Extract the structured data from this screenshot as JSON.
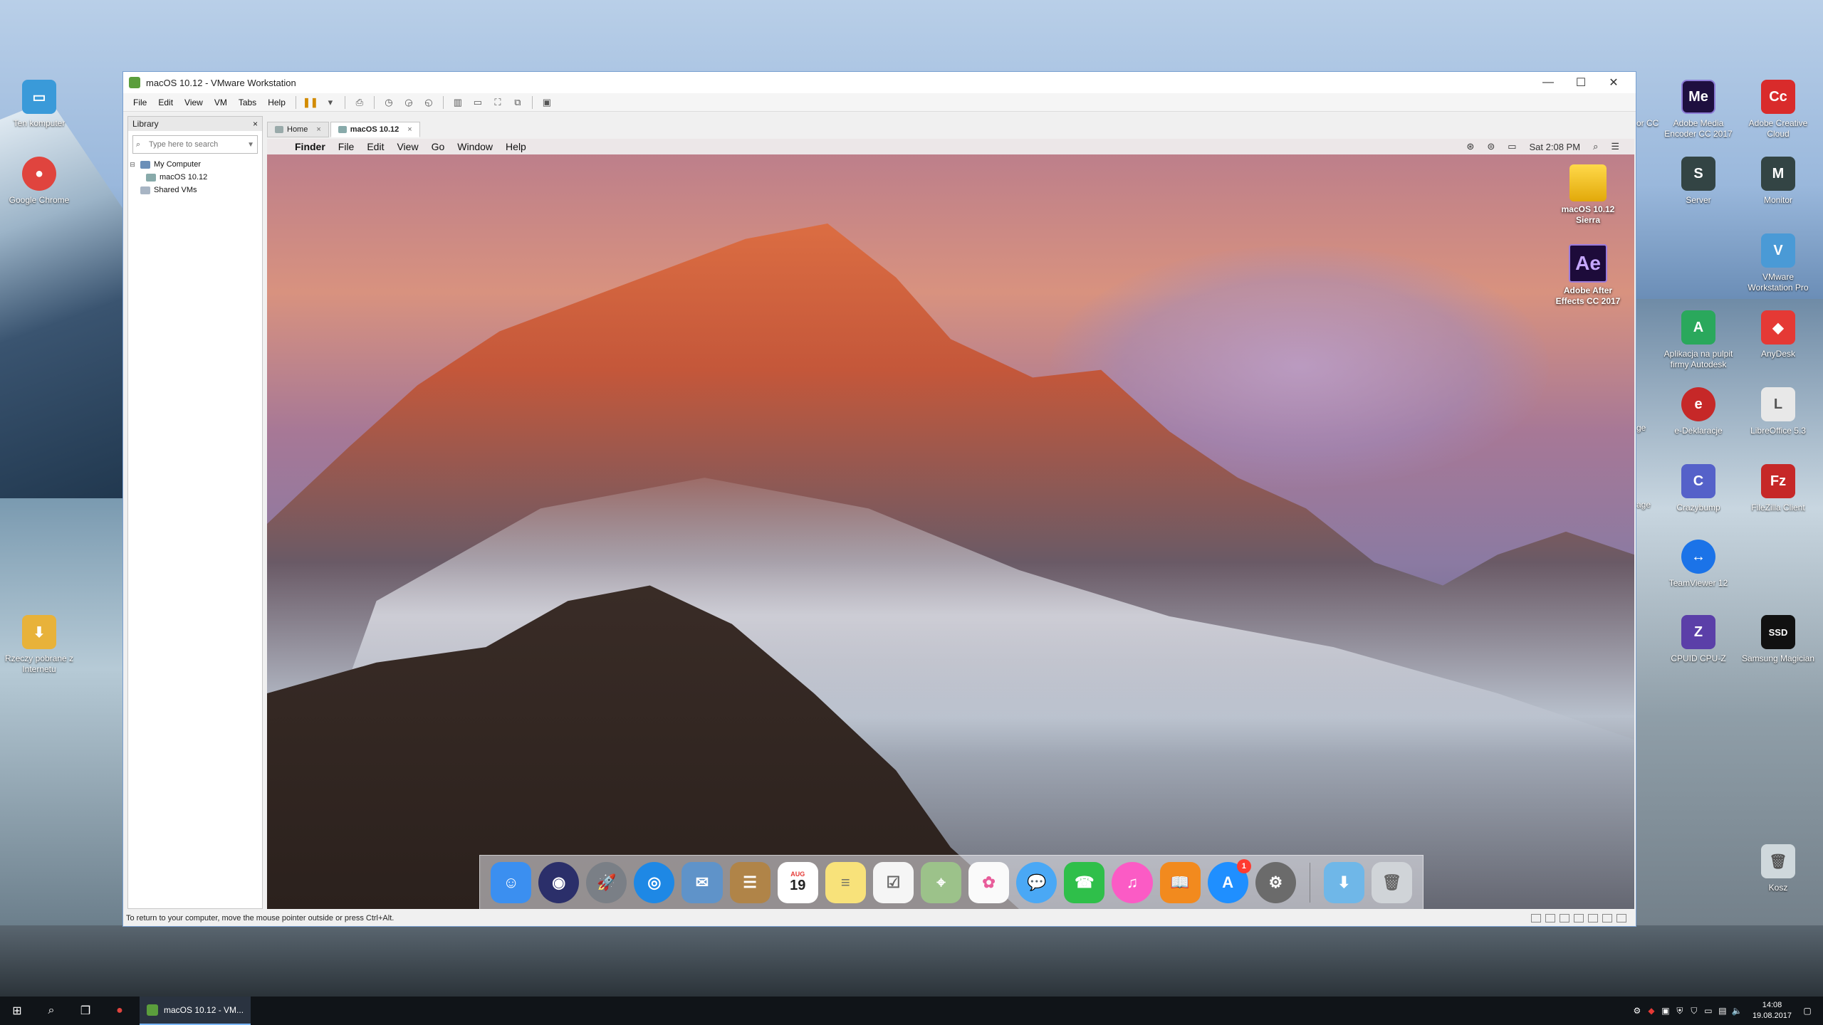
{
  "desktop": {
    "left_icons": [
      {
        "label": "Ten komputer",
        "icon": "computer-icon",
        "color": "#3a9ad9"
      },
      {
        "label": "Google Chrome",
        "icon": "chrome-icon",
        "color": "#e0443e"
      },
      {
        "label": "Rzeczy pobrane z Internetu",
        "icon": "downloads-folder-icon",
        "color": "#e8b23a"
      }
    ],
    "right_icons": [
      {
        "label": "Adobe Media Encoder CC 2017",
        "short": "Me",
        "color": "#1e0f3f"
      },
      {
        "label": "Adobe Creative Cloud",
        "short": "Cc",
        "color": "#d92b2b"
      },
      {
        "label": "Server",
        "short": "S",
        "color": "#344"
      },
      {
        "label": "Monitor",
        "short": "M",
        "color": "#344"
      },
      {
        "label": "VMware Workstation Pro",
        "short": "V",
        "color": "#4a9ad6"
      },
      {
        "label": "Aplikacja na pulpit firmy Autodesk",
        "short": "A",
        "color": "#2aa85c"
      },
      {
        "label": "AnyDesk",
        "short": "◆",
        "color": "#e53935"
      },
      {
        "label": "e-Deklaracje",
        "short": "e",
        "color": "#c62828"
      },
      {
        "label": "LibreOffice 5.3",
        "short": "L",
        "color": "#e8e8e8"
      },
      {
        "label": "Crazybump",
        "short": "C",
        "color": "#5561c9"
      },
      {
        "label": "FileZilla Client",
        "short": "Fz",
        "color": "#c62828"
      },
      {
        "label": "TeamViewer 12",
        "short": "↔",
        "color": "#1b73e8"
      },
      {
        "label": "CPUID CPU-Z",
        "short": "Z",
        "color": "#5b3fa8"
      },
      {
        "label": "Samsung Magician",
        "short": "SSD",
        "color": "#111"
      },
      {
        "label": "Kosz",
        "short": "🗑",
        "color": "#cfd8dc"
      }
    ],
    "partial_labels": [
      "or CC",
      "ge",
      "age"
    ]
  },
  "vmware": {
    "title": "macOS 10.12 - VMware Workstation",
    "window_controls": {
      "minimize": "—",
      "maximize": "☐",
      "close": "✕"
    },
    "menu": [
      "File",
      "Edit",
      "View",
      "VM",
      "Tabs",
      "Help"
    ],
    "library": {
      "header": "Library",
      "close": "×",
      "search_placeholder": "Type here to search",
      "tree": [
        {
          "label": "My Computer",
          "level": 0,
          "expander": "⊟"
        },
        {
          "label": "macOS 10.12",
          "level": 1,
          "expander": ""
        },
        {
          "label": "Shared VMs",
          "level": 0,
          "expander": ""
        }
      ]
    },
    "tabs": [
      {
        "label": "Home",
        "active": false
      },
      {
        "label": "macOS 10.12",
        "active": true
      }
    ],
    "status_text": "To return to your computer, move the mouse pointer outside or press Ctrl+Alt."
  },
  "mac": {
    "menu": [
      "Finder",
      "File",
      "Edit",
      "View",
      "Go",
      "Window",
      "Help"
    ],
    "clock": "Sat 2:08 PM",
    "desktop_icons": [
      {
        "label": "macOS 10.12 Sierra"
      },
      {
        "label": "Adobe After Effects CC 2017",
        "short": "Ae"
      }
    ],
    "dock": [
      {
        "name": "finder",
        "glyph": "☺",
        "color": "#3b8ff0"
      },
      {
        "name": "siri",
        "glyph": "◉",
        "color": "#2b2f6a"
      },
      {
        "name": "launchpad",
        "glyph": "🚀",
        "color": "#7a7f86"
      },
      {
        "name": "safari",
        "glyph": "◎",
        "color": "#1e88e5"
      },
      {
        "name": "mail",
        "glyph": "✉",
        "color": "#5f93c9"
      },
      {
        "name": "contacts",
        "glyph": "☰",
        "color": "#b08448"
      },
      {
        "name": "calendar",
        "glyph": "19",
        "color": "#ffffff",
        "sub": "AUG"
      },
      {
        "name": "notes",
        "glyph": "≡",
        "color": "#f8e27a"
      },
      {
        "name": "reminders",
        "glyph": "☑",
        "color": "#f5f5f5"
      },
      {
        "name": "maps",
        "glyph": "⌖",
        "color": "#9cc28a"
      },
      {
        "name": "photos",
        "glyph": "✿",
        "color": "#fafafa"
      },
      {
        "name": "messages",
        "glyph": "💬",
        "color": "#4aa8f5"
      },
      {
        "name": "facetime",
        "glyph": "☎",
        "color": "#2fbf4a"
      },
      {
        "name": "itunes",
        "glyph": "♫",
        "color": "#fb5bc5"
      },
      {
        "name": "ibooks",
        "glyph": "📖",
        "color": "#f28a1e"
      },
      {
        "name": "app-store",
        "glyph": "A",
        "color": "#1f8fff",
        "badge": "1"
      },
      {
        "name": "system-preferences",
        "glyph": "⚙",
        "color": "#6b6b6b"
      }
    ],
    "dock_right": [
      {
        "name": "downloads",
        "glyph": "⬇",
        "color": "#6fb7e8"
      },
      {
        "name": "trash",
        "glyph": "🗑",
        "color": "#d0d4d8"
      }
    ]
  },
  "taskbar": {
    "app_label": "macOS 10.12 - VM...",
    "time": "14:08",
    "date": "19.08.2017"
  }
}
